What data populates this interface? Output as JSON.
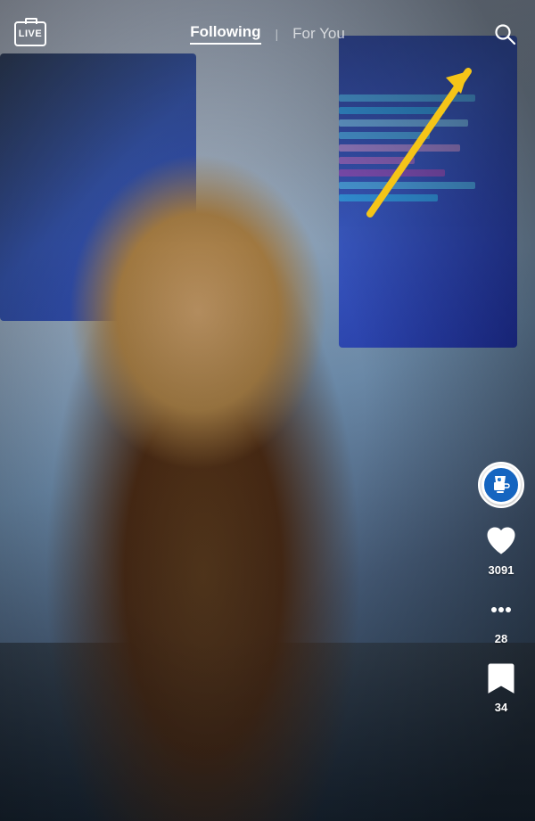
{
  "header": {
    "live_label": "LIVE",
    "following_label": "Following",
    "for_you_label": "For You",
    "active_tab": "following",
    "separator": "|"
  },
  "actions": {
    "like_count": "3091",
    "comment_count": "28",
    "bookmark_count": "34"
  },
  "colors": {
    "arrow_color": "#F5C518",
    "live_border": "#ffffff",
    "active_tab_underline": "#ffffff"
  }
}
